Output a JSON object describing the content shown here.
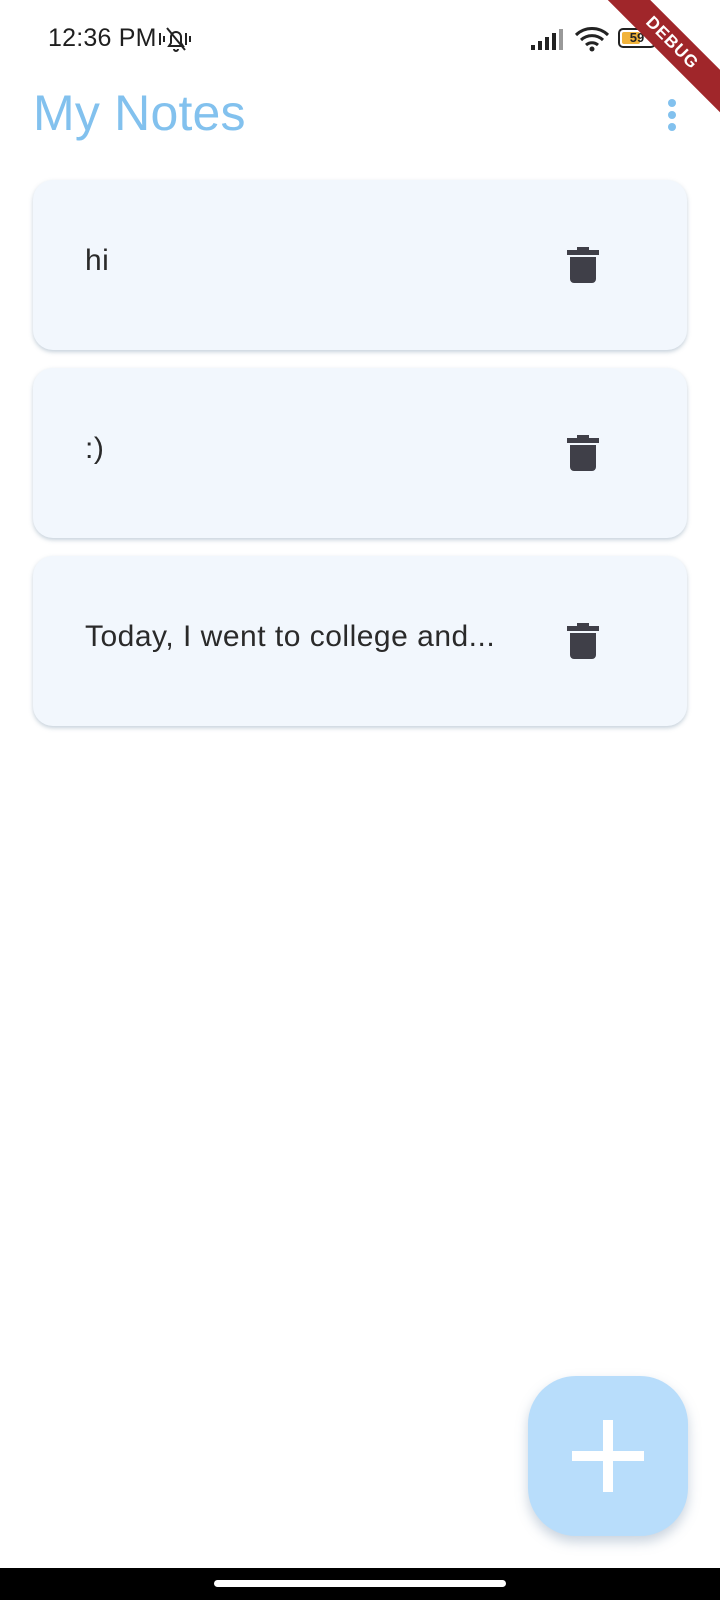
{
  "status_bar": {
    "time": "12:36 PM",
    "battery_level": 59,
    "battery_text": "59",
    "icons": [
      "mute-icon",
      "signal-icon",
      "wifi-icon",
      "battery-icon"
    ]
  },
  "debug_banner": "DEBUG",
  "app_bar": {
    "title": "My Notes",
    "menu_icon": "more-vert-icon"
  },
  "notes": [
    {
      "text": "hi",
      "delete_icon": "trash-icon"
    },
    {
      "text": ":)",
      "delete_icon": "trash-icon"
    },
    {
      "text": "Today, I went to college and...",
      "delete_icon": "trash-icon"
    }
  ],
  "fab": {
    "icon": "plus-icon"
  },
  "colors": {
    "title": "#82c1ee",
    "card_background": "#f2f7fd",
    "fab_background": "#b8ddfb",
    "icon_dark": "#3f3f48",
    "debug_ribbon": "#a0262a"
  }
}
